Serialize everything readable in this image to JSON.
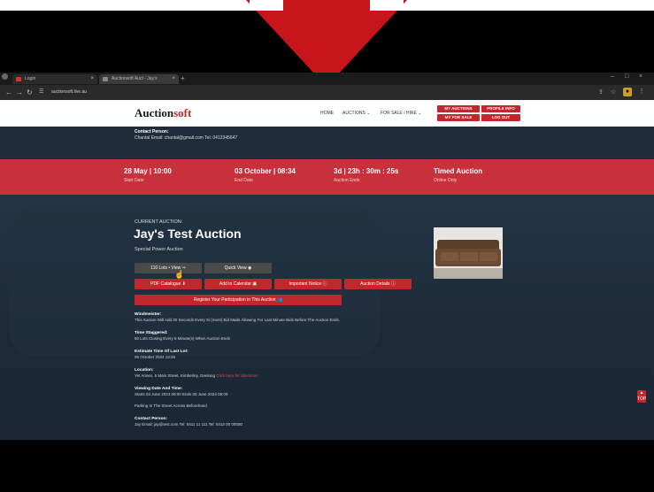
{
  "browser": {
    "tabs": [
      {
        "label": "Login"
      },
      {
        "label": "Auctionsoft Auct - Jay's"
      }
    ],
    "new_tab": "+",
    "url": "auctionsoft.live.au",
    "window_controls": [
      "–",
      "□",
      "×"
    ]
  },
  "site": {
    "logo_main": "Auction",
    "logo_accent": "soft",
    "nav": [
      "HOME",
      "AUCTIONS ⌄",
      "FOR SALE / HIRE ⌄"
    ],
    "account_buttons": [
      "MY AUCTIONS",
      "PROFILE INFO",
      "MY FOR SALE",
      "LOG OUT"
    ]
  },
  "contact_top": {
    "label": "Contact Person:",
    "text": "Chantal   Email: chantal@gmail.com   Tel: 0412345647"
  },
  "stats": [
    {
      "value": "28 May | 10:00",
      "label": "Start Date"
    },
    {
      "value": "03 October | 08:34",
      "label": "End Date"
    },
    {
      "value": "3d | 23h : 30m : 25s",
      "label": "Auction Ends"
    },
    {
      "value": "Timed Auction",
      "label": "Online Only"
    }
  ],
  "auction": {
    "current_label": "CURRENT AUCTION:",
    "title": "Jay's Test Auction",
    "subtitle": "Special Power Auction"
  },
  "buttons": {
    "lots_view": "110 Lots • View ⇒",
    "quick_view": "Quick View ◉",
    "pdf_catalogue": "PDF Catalogue ⬇",
    "add_to_calendar": "Add to Calendar ▣",
    "important_notice": "Important Notice ⓘ",
    "auction_details": "Auction Details ⓘ",
    "register": "Register Your Participation in This Auction 👥"
  },
  "info": {
    "wind_label": "Windmeister:",
    "wind_text": "This Auction Will Add 30 Seconds Every Si (ment) Bid Made Allowing For Last Minute Bids Before The Auction Ends.",
    "time_label": "Time Staggered:",
    "time_text": "50 Lots Closing Every 5 Minute(s) When Auction Ends",
    "est_label": "Estimate Time Of Last Lot:",
    "est_text": "05 October 2024 13:25",
    "loc_label": "Location:",
    "loc_text": "Yet Annex, 5 Main Street, Kimberley, Geelong",
    "loc_link": "Click here for directions",
    "view_label": "Viewing Date And Time:",
    "view_text": "Starts 03 June 2024 09:00    Ends 05 June 2024 09:00",
    "parking_text": "Parking In The Street Across Beforehand",
    "contact_label": "Contact Person:",
    "contact_text": "Jay    Email: jay@test.com    Tel: 0411 11 111    Tel: 0412 00 00000"
  },
  "scroll_top": "▲ TOP",
  "colors": {
    "brand_red": "#c1272d",
    "band_red": "#c8313b",
    "page_bg": "#1f2d3b"
  }
}
